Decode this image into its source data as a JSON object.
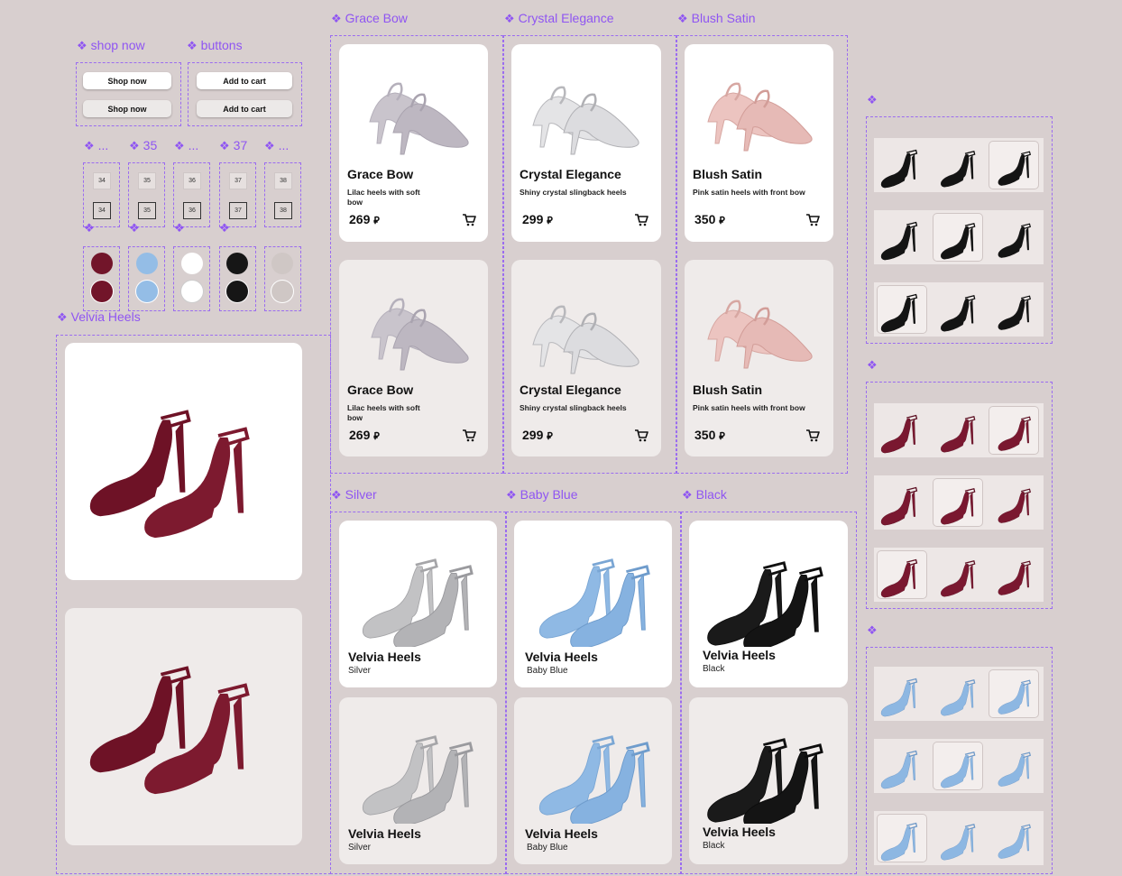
{
  "labels": {
    "shop_now": "shop now",
    "buttons": "buttons",
    "size_dots_1": "...",
    "size_35": "35",
    "size_dots_2": "...",
    "size_37": "37",
    "size_dots_3": "...",
    "velvia_heels": "Velvia Heels",
    "grace_bow": "Grace Bow",
    "crystal_elegance": "Crystal Elegance",
    "blush_satin": "Blush Satin",
    "silver": "Silver",
    "baby_blue": "Baby Blue",
    "black": "Black"
  },
  "buttons": {
    "shop_now": "Shop now",
    "add_to_cart": "Add to cart"
  },
  "sizes": [
    "34",
    "35",
    "36",
    "37",
    "38"
  ],
  "colors": {
    "burgundy": "#72152a",
    "baby_blue": "#94bde6",
    "white": "#ffffff",
    "black": "#161616",
    "light_gray": "#cfc7c5",
    "accent": "#8f55f2"
  },
  "cards": {
    "grace": {
      "title": "Grace Bow",
      "desc": "Lilac heels with soft bow",
      "price": "269"
    },
    "crystal": {
      "title": "Crystal Elegance",
      "desc": "Shiny crystal slingback heels",
      "price": "299"
    },
    "blush": {
      "title": "Blush Satin",
      "desc": "Pink satin heels with front bow",
      "price": "350"
    }
  },
  "velvia": {
    "title": "Velvia Heels",
    "silver": "Silver",
    "baby_blue": "Baby Blue",
    "black": "Black"
  },
  "currency": "⃁",
  "icons": {
    "component": "diamond-component-icon",
    "cart": "cart-icon"
  }
}
